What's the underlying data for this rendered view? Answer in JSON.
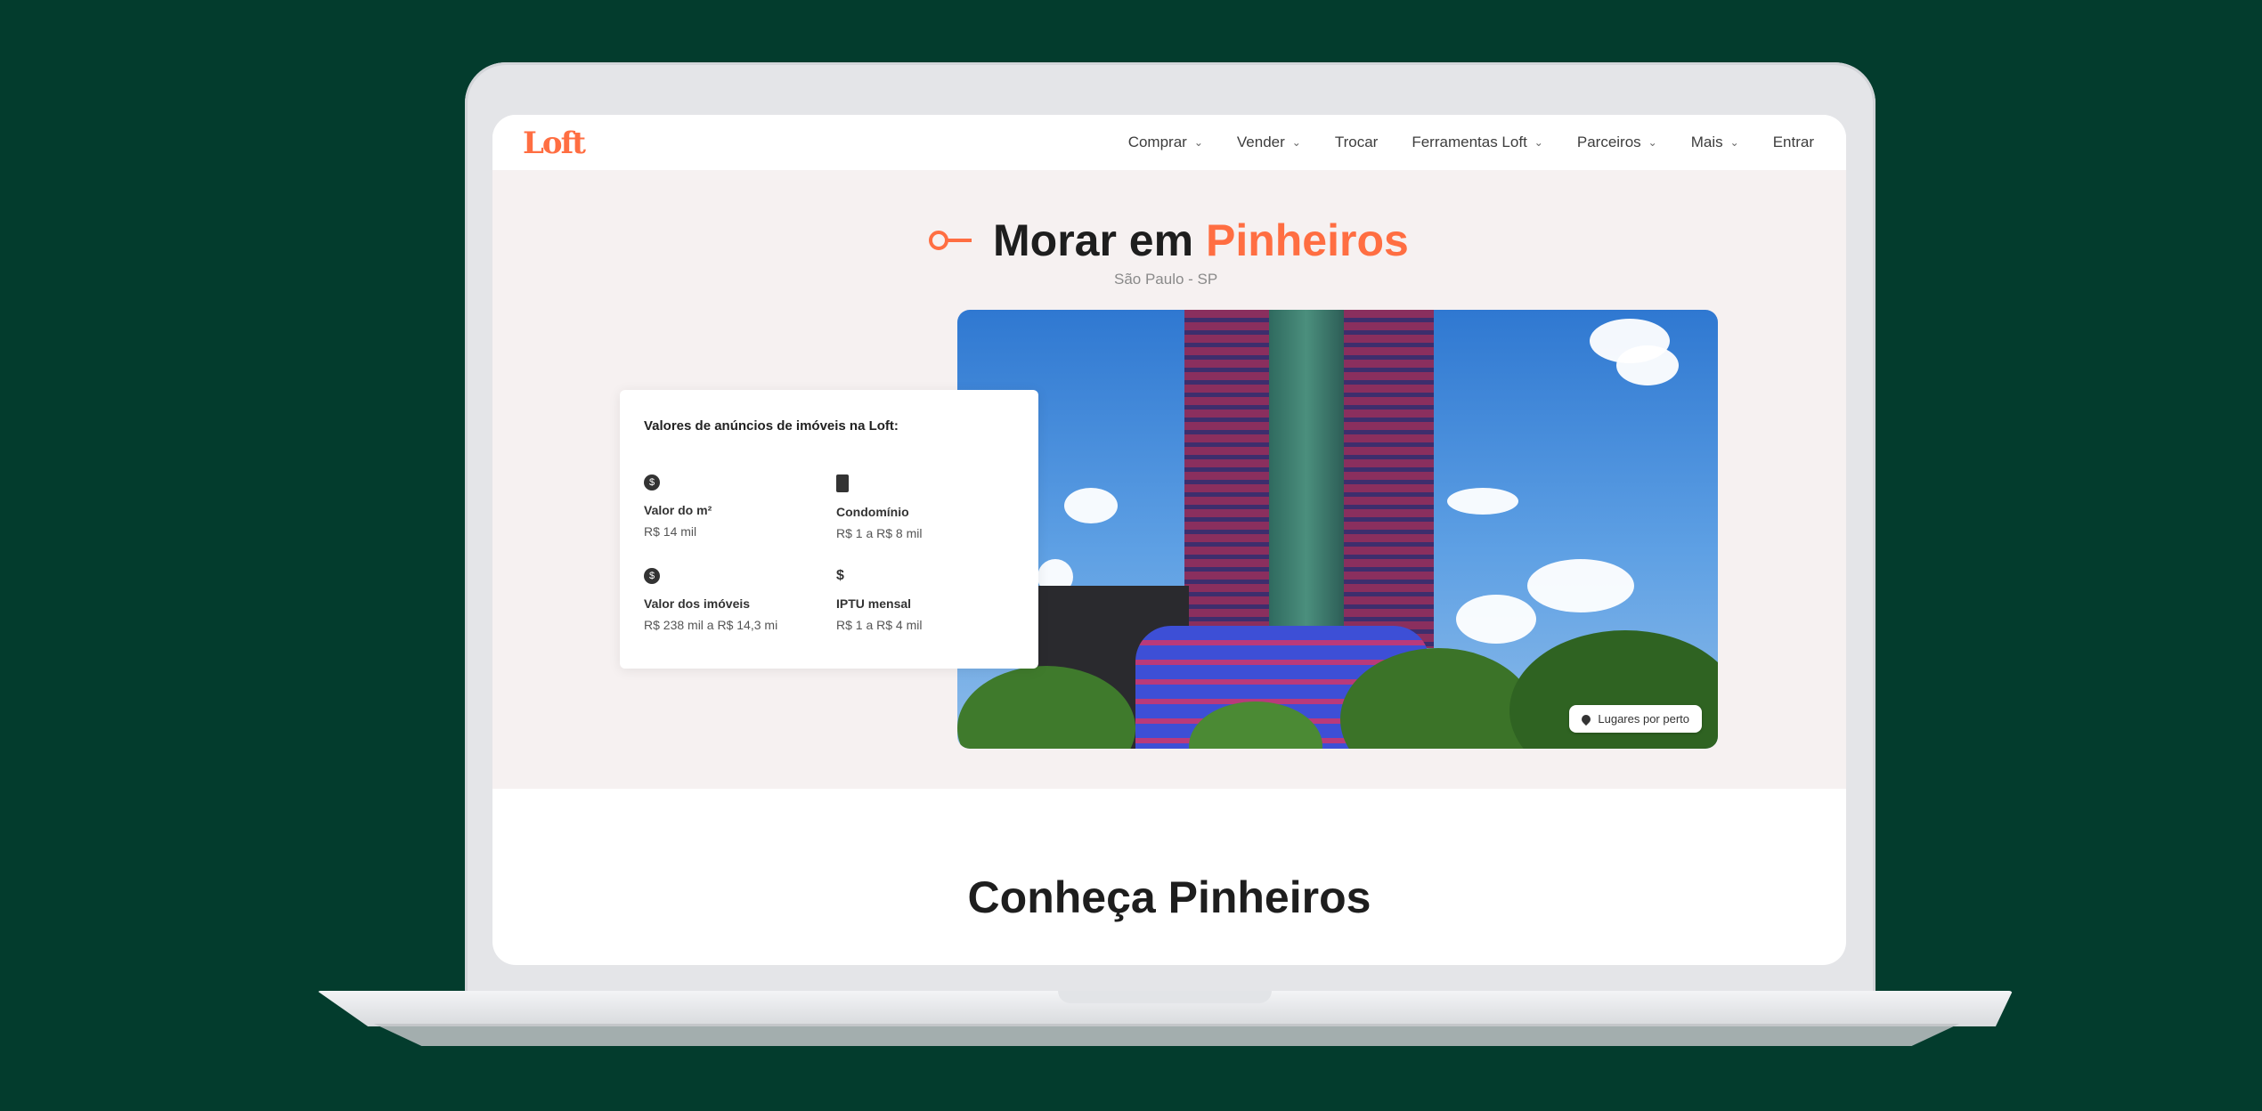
{
  "nav": {
    "logo": "Loft",
    "items": [
      {
        "label": "Comprar",
        "has_menu": true
      },
      {
        "label": "Vender",
        "has_menu": true
      },
      {
        "label": "Trocar",
        "has_menu": false
      },
      {
        "label": "Ferramentas Loft",
        "has_menu": true
      },
      {
        "label": "Parceiros",
        "has_menu": true
      },
      {
        "label": "Mais",
        "has_menu": true
      },
      {
        "label": "Entrar",
        "has_menu": false
      }
    ]
  },
  "hero": {
    "title_prefix": "Morar em ",
    "title_accent": "Pinheiros",
    "subtitle": "São Paulo - SP",
    "photo_badge": "Lugares por perto"
  },
  "card": {
    "title": "Valores de anúncios de imóveis na Loft:",
    "stats": [
      {
        "label": "Valor do m²",
        "value": "R$ 14 mil",
        "icon": "coin-icon"
      },
      {
        "label": "Condomínio",
        "value": "R$ 1 a R$ 8 mil",
        "icon": "building-icon"
      },
      {
        "label": "Valor dos imóveis",
        "value": "R$ 238 mil a R$ 14,3 mi",
        "icon": "coin-icon"
      },
      {
        "label": "IPTU mensal",
        "value": "R$ 1 a R$ 4 mil",
        "icon": "dollar-icon"
      }
    ]
  },
  "section": {
    "title": "Conheça Pinheiros"
  },
  "colors": {
    "brand": "#ff6e42",
    "background": "#033c2d",
    "hero_bg": "#f6f1f1"
  }
}
